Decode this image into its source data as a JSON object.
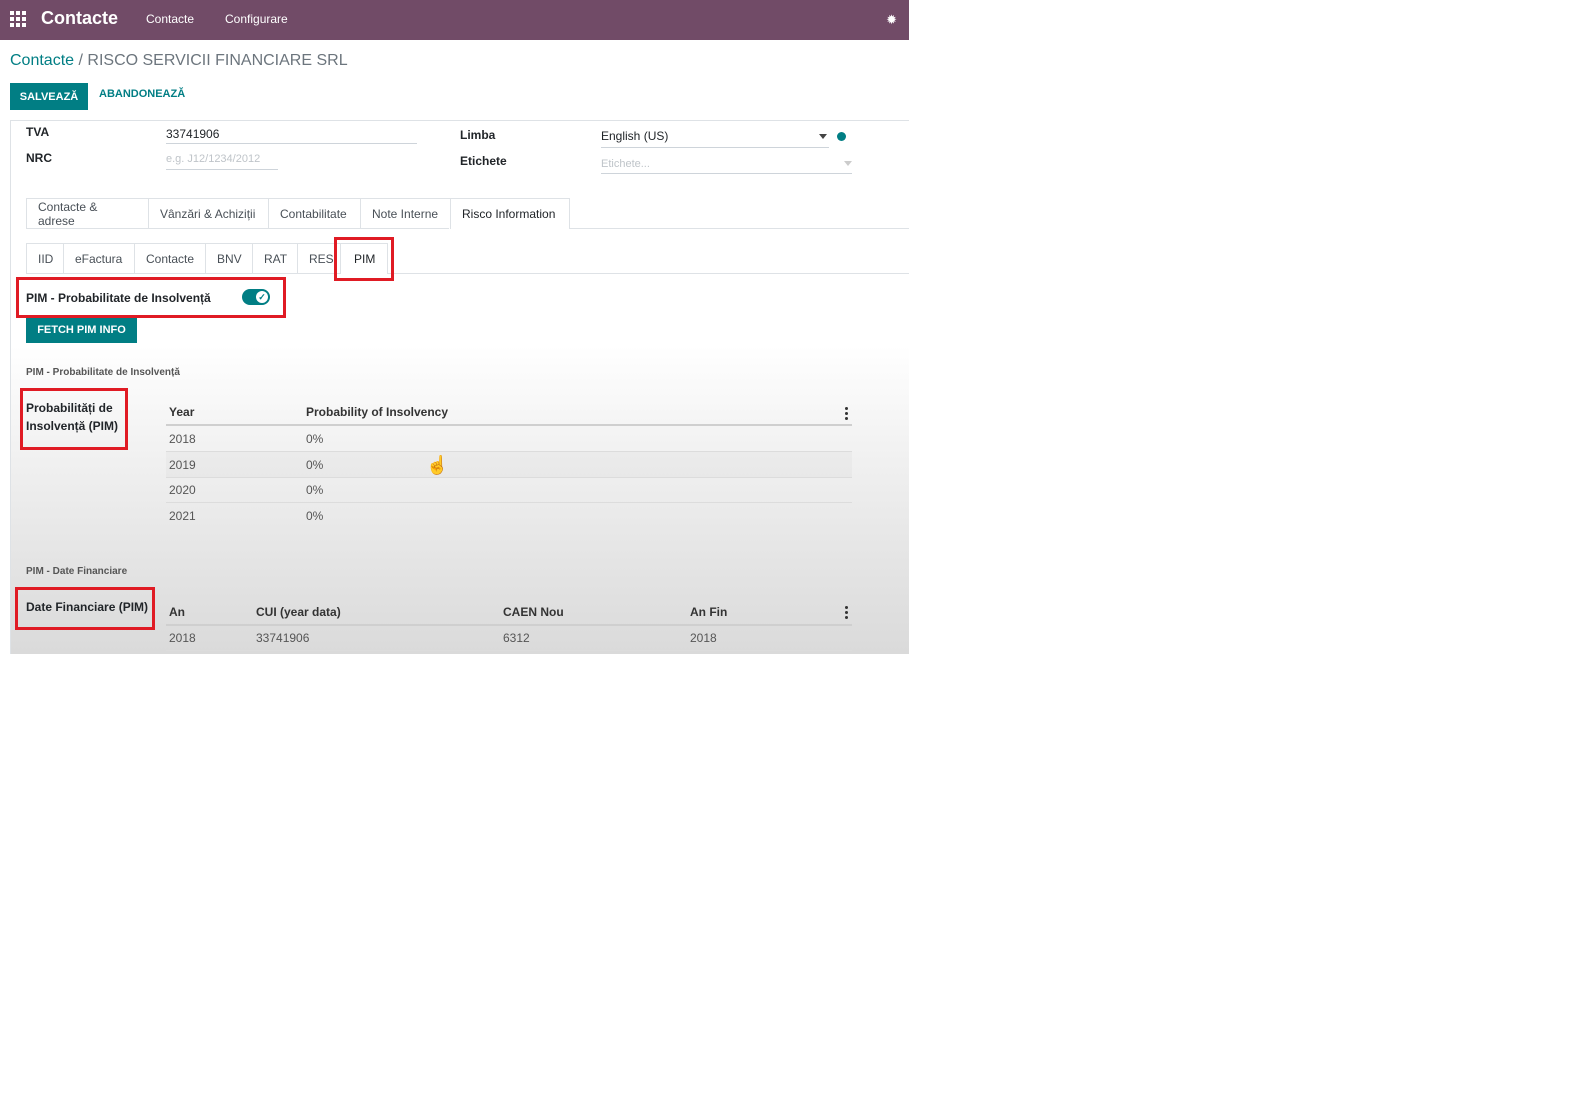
{
  "navbar": {
    "brand": "Contacte",
    "menu": [
      "Contacte",
      "Configurare"
    ],
    "color": "#714B67"
  },
  "breadcrumb": {
    "parent": "Contacte",
    "separator": " / ",
    "current": "RISCO SERVICII FINANCIARE SRL"
  },
  "actions": {
    "save": "SALVEAZĂ",
    "discard": "ABANDONEAZĂ"
  },
  "fields": {
    "tva_label": "TVA",
    "tva_value": "33741906",
    "nrc_label": "NRC",
    "nrc_placeholder": "e.g. J12/1234/2012",
    "limba_label": "Limba",
    "limba_value": "English (US)",
    "etichete_label": "Etichete",
    "etichete_placeholder": "Etichete..."
  },
  "tabs": [
    "Contacte & adrese",
    "Vânzări & Achiziții",
    "Contabilitate",
    "Note Interne",
    "Risco Information"
  ],
  "active_tab": "Risco Information",
  "subtabs": [
    "IID",
    "eFactura",
    "Contacte",
    "BNV",
    "RAT",
    "RES",
    "PIM"
  ],
  "active_subtab": "PIM",
  "pim": {
    "toggle_label": "PIM - Probabilitate de Insolvență",
    "toggle_on": true,
    "fetch_button": "FETCH PIM INFO",
    "section1_title": "PIM - Probabilitate de Insolvență",
    "section1_label": "Probabilități de Insolvență (PIM)",
    "prob_table": {
      "headers": [
        "Year",
        "Probability of Insolvency"
      ],
      "rows": [
        [
          "2018",
          "0%"
        ],
        [
          "2019",
          "0%"
        ],
        [
          "2020",
          "0%"
        ],
        [
          "2021",
          "0%"
        ]
      ]
    },
    "section2_title": "PIM - Date Financiare",
    "section2_label": "Date Financiare (PIM)",
    "fin_table": {
      "headers": [
        "An",
        "CUI (year data)",
        "CAEN Nou",
        "An Fin"
      ],
      "rows": [
        [
          "2018",
          "33741906",
          "6312",
          "2018"
        ]
      ]
    }
  },
  "colors": {
    "primary": "#017e84",
    "highlight": "#e01b24"
  }
}
